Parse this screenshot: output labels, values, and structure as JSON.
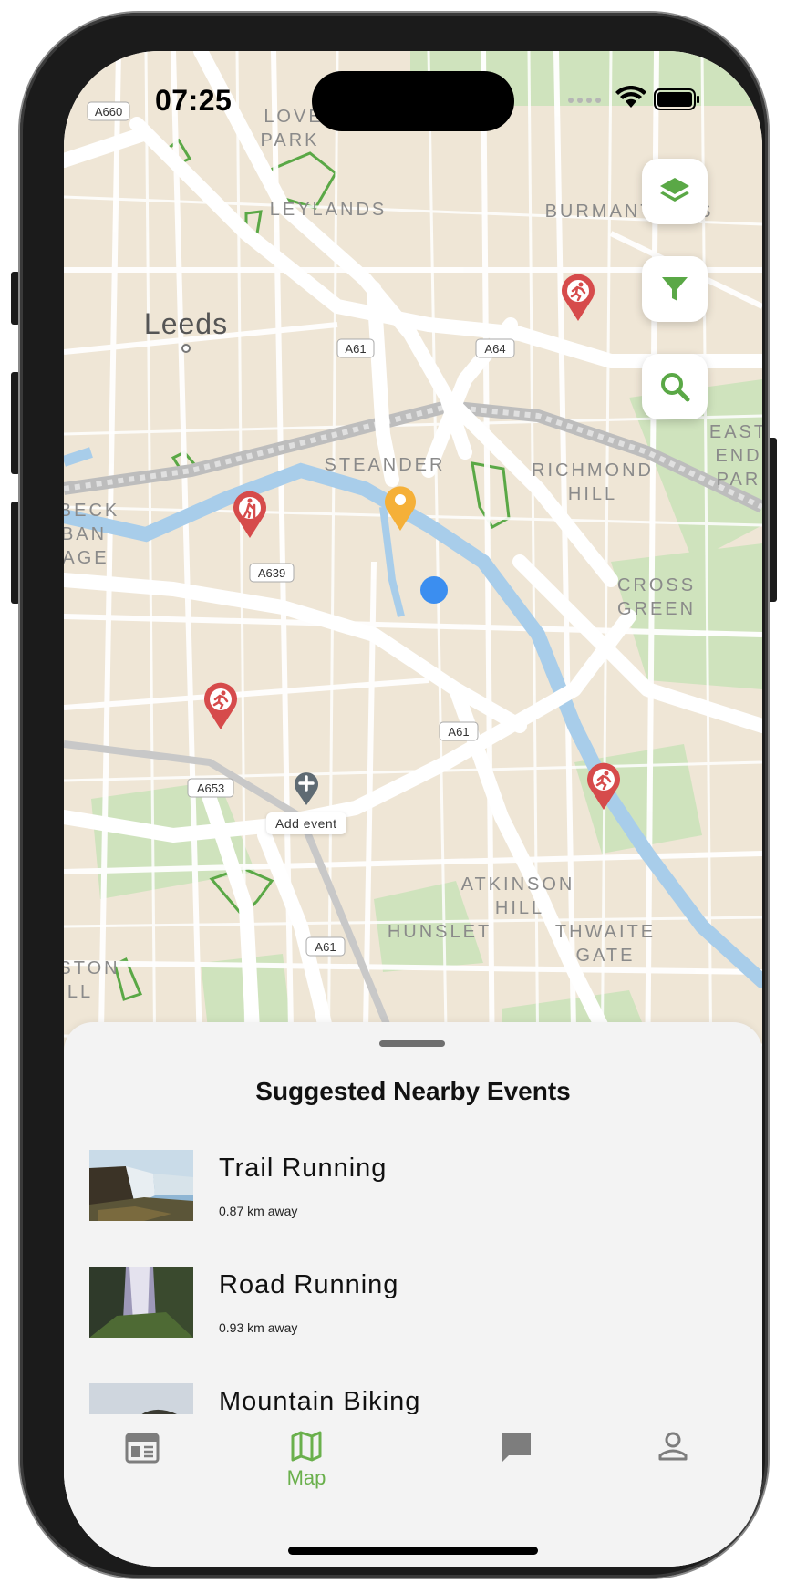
{
  "status_bar": {
    "time": "07:25"
  },
  "map": {
    "place_labels": [
      "LOVELL PARK",
      "LEYLANDS",
      "BURMANTOFTS",
      "Leeds",
      "STEANDER",
      "RICHMOND HILL",
      "EAST END PARK",
      "BECK BAN AGE",
      "CROSS GREEN",
      "ATKINSON HILL",
      "HUNSLET",
      "THWAITE GATE",
      "STON LL"
    ],
    "road_labels": [
      "A660",
      "A61",
      "A64",
      "A639",
      "A61",
      "A653",
      "A61"
    ],
    "add_event_label": "Add event",
    "pins": [
      {
        "type": "running",
        "color": "#d64b4b"
      },
      {
        "type": "hiking",
        "color": "#d64b4b"
      },
      {
        "type": "running",
        "color": "#d64b4b"
      },
      {
        "type": "running",
        "color": "#d64b4b"
      },
      {
        "type": "selected-location",
        "color": "#f5b038"
      },
      {
        "type": "add-event",
        "color": "#5f6b73"
      }
    ],
    "user_location_color": "#3b8ef0"
  },
  "controls": {
    "layers": "layers-icon",
    "filter": "filter-icon",
    "search": "search-icon",
    "accent": "#5aa846"
  },
  "sheet": {
    "title": "Suggested Nearby Events",
    "events": [
      {
        "name": "Trail Running",
        "distance": "0.87 km away"
      },
      {
        "name": "Road Running",
        "distance": "0.93 km away"
      },
      {
        "name": "Mountain Biking",
        "distance": ""
      }
    ]
  },
  "tabs": [
    {
      "icon": "calendar-icon",
      "label": ""
    },
    {
      "icon": "map-icon",
      "label": "Map",
      "active": true
    },
    {
      "icon": "chat-icon",
      "label": ""
    },
    {
      "icon": "profile-icon",
      "label": ""
    }
  ]
}
